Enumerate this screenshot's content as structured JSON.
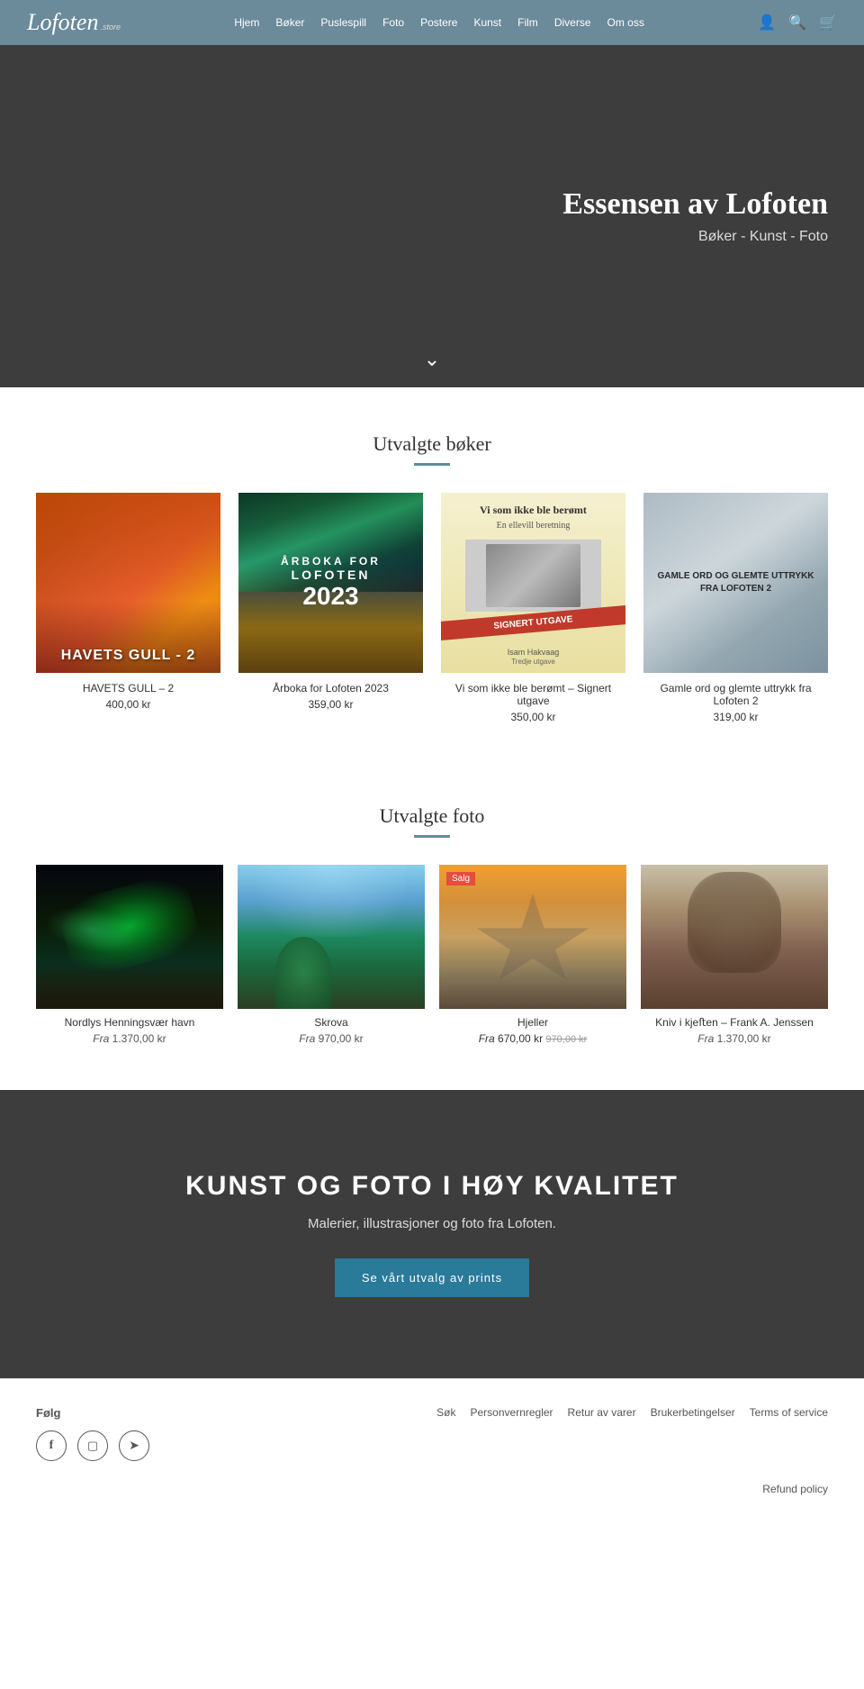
{
  "header": {
    "logo": "Lofoten",
    "logo_sup": ".store",
    "nav_items": [
      "Hjem",
      "Bøker",
      "Puslespill",
      "Foto",
      "Postere",
      "Kunst",
      "Film",
      "Diverse",
      "Om oss"
    ]
  },
  "hero": {
    "title": "Essensen av Lofoten",
    "subtitle": "Bøker - Kunst - Foto",
    "arrow": "∨"
  },
  "books_section": {
    "title": "Utvalgte bøker",
    "products": [
      {
        "id": "havets",
        "name": "HAVETS GULL – 2",
        "price": "400,00 kr"
      },
      {
        "id": "arboka",
        "name": "Årboka for Lofoten 2023",
        "price": "359,00 kr"
      },
      {
        "id": "visom",
        "name": "Vi som ikke ble berømt – Signert utgave",
        "price": "350,00 kr"
      },
      {
        "id": "gamle",
        "name": "Gamle ord og glemte uttrykk fra Lofoten 2",
        "price": "319,00 kr"
      }
    ]
  },
  "photo_section": {
    "title": "Utvalgte foto",
    "products": [
      {
        "id": "nordlys",
        "name": "Nordlys Henningsvær havn",
        "price": "Fra 1.370,00 kr",
        "sale": false
      },
      {
        "id": "skrova",
        "name": "Skrova",
        "price": "Fra 970,00 kr",
        "sale": false
      },
      {
        "id": "hjeller",
        "name": "Hjeller",
        "price": "Fra 670,00 kr",
        "price_original": "Fra 970,00 kr",
        "sale": true
      },
      {
        "id": "kniv",
        "name": "Kniv i kjeﬅen – Frank A. Jenssen",
        "price": "Fra 1.370,00 kr",
        "sale": false
      }
    ]
  },
  "dark_section": {
    "title": "KUNST OG FOTO I HØY KVALITET",
    "description": "Malerier, illustrasjoner og foto fra Lofoten.",
    "cta": "Se vårt utvalg av prints"
  },
  "footer": {
    "follow_label": "Følg",
    "social_icons": [
      "f",
      "insta",
      "send"
    ],
    "links": [
      "Søk",
      "Personvernregler",
      "Retur av varer",
      "Brukerbetingelser",
      "Terms of service"
    ],
    "links2": [
      "Refund policy"
    ]
  },
  "book_labels": {
    "havets_line1": "HAVETS GULL - 2",
    "arboka_line1": "ÅRBOKA FOR",
    "arboka_line2": "LOFOTEN",
    "arboka_year": "2023",
    "visom_title": "Vi som ikke ble berømt",
    "visom_sub": "En ellevill beretning",
    "visom_badge": "SIGNERT UTGAVE",
    "visom_author": "Isam Hakvaag",
    "visom_edition": "Tredje utgave",
    "gamle_title": "GAMLE ORD OG GLEMTE UTTRYKK FRA LOFOTEN 2"
  }
}
